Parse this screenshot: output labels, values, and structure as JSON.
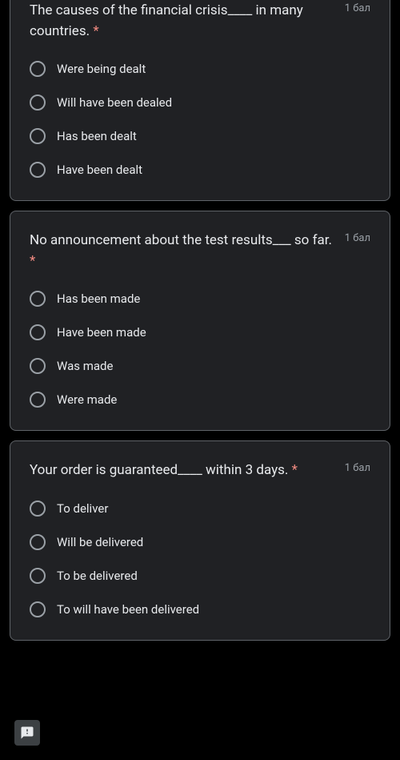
{
  "questions": [
    {
      "text": "The causes of the financial crisis____ in many countries.",
      "points": "1 бал",
      "options": [
        "Were being dealt",
        "Will have been dealed",
        "Has been dealt",
        "Have been dealt"
      ]
    },
    {
      "text": "No announcement about the test results___ so far.",
      "points": "1 бал",
      "options": [
        "Has been made",
        "Have been made",
        "Was made",
        "Were made"
      ]
    },
    {
      "text": "Your order is guaranteed____ within 3 days.",
      "points": "1 бал",
      "options": [
        "To deliver",
        "Will be delivered",
        "To be delivered",
        "To will have been delivered"
      ]
    }
  ],
  "required_marker": "*"
}
